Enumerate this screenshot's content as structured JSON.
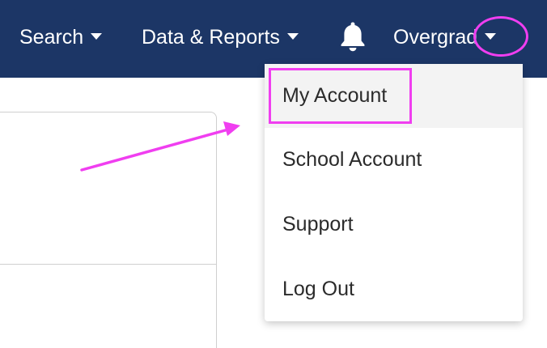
{
  "nav": {
    "search_label": "Search",
    "data_reports_label": "Data & Reports",
    "user_label": "Overgrad"
  },
  "dropdown": {
    "items": [
      {
        "label": "My Account"
      },
      {
        "label": "School Account"
      },
      {
        "label": "Support"
      },
      {
        "label": "Log Out"
      }
    ]
  },
  "icons": {
    "bell": "bell-icon",
    "caret": "caret-down-icon"
  },
  "colors": {
    "nav_background": "#1c3666",
    "annotation": "#f03ef0",
    "active_item_background": "#f3f3f3"
  }
}
